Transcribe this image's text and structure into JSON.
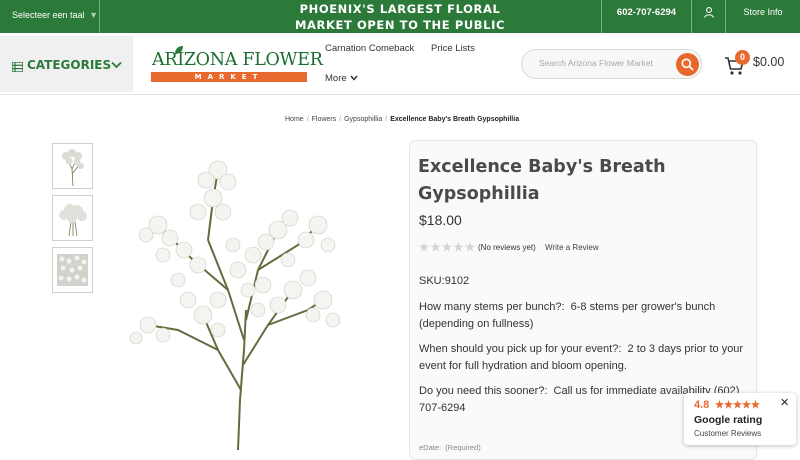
{
  "topbar": {
    "language_label": "Selecteer een taal",
    "language_sep": "▼",
    "banner": "PHOENIX'S LARGEST FLORAL MARKET OPEN TO THE PUBLIC",
    "phone": "602-707-6294",
    "store_info": "Store Info"
  },
  "header": {
    "categories_label": "CATEGORIES",
    "logo_name": "ARIZONA FLOWER",
    "logo_sub": "MARKET",
    "nav": [
      "Carnation Comeback",
      "Price Lists",
      "More"
    ],
    "search_placeholder": "Search Arizona Flower Market",
    "cart_count": "0",
    "cart_total": "$0.00"
  },
  "breadcrumb": [
    "Home",
    "Flowers",
    "Gypsophillia",
    "Excellence Baby's Breath Gypsophillia"
  ],
  "product": {
    "title": "Excellence Baby's Breath Gypsophillia",
    "price": "$18.00",
    "rating_stars": 0,
    "no_reviews": "(No reviews yet)",
    "write_review": "Write a Review",
    "sku_label": "SKU:",
    "sku_value": "9102",
    "q1_label": "How many stems per bunch?:",
    "q1_value": "6-8 stems per grower's bunch (depending on fullness)",
    "q2_label": "When should you pick up for your event?:",
    "q2_value": "2 to 3 days prior to your event for full hydration and bloom opening.",
    "q3_label": "Do you need this sooner?:",
    "q3_value": "Call us for immediate availability (602) 707-6294",
    "edate_label": "eDate:",
    "edate_required": "(Required)"
  },
  "google_badge": {
    "rating": "4.8",
    "title": "Google rating",
    "subtitle": "Customer Reviews",
    "close": "✕"
  },
  "colors": {
    "brand_green": "#2c7a3a",
    "accent_orange": "#e8692d"
  }
}
